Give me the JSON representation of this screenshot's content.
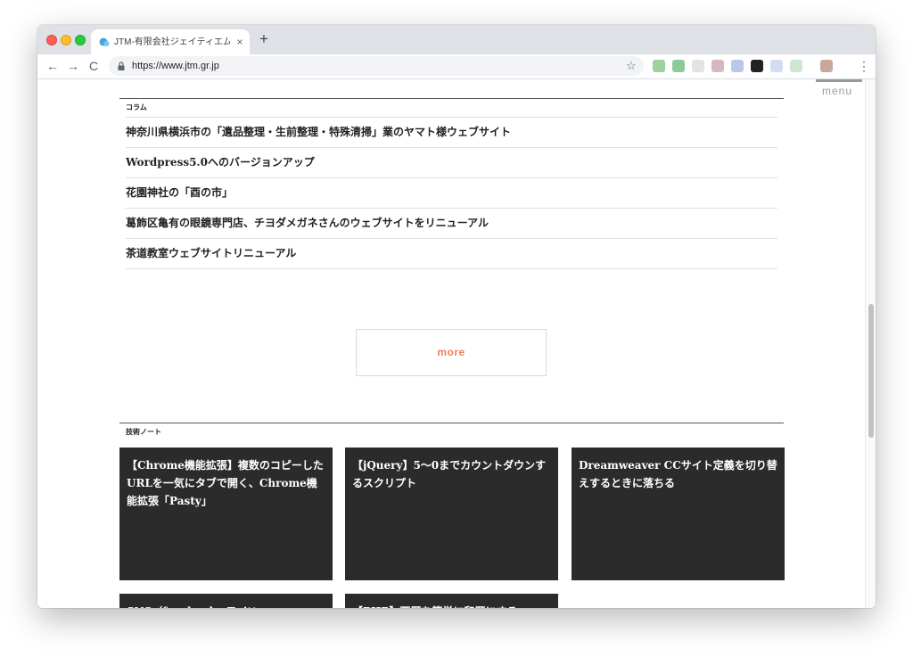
{
  "browser": {
    "tab_title": "JTM-有限会社ジェイティエム [W",
    "tab_close": "×",
    "new_tab": "+",
    "url": "https://www.jtm.gr.jp",
    "back": "←",
    "forward": "→",
    "reload": "C",
    "bookmark_star": "☆",
    "menu_dots": "⋮"
  },
  "site": {
    "menu_label": "menu"
  },
  "column": {
    "heading": "コラム",
    "items": [
      "神奈川県横浜市の「遺品整理・生前整理・特殊清掃」業のヤマト様ウェブサイト",
      "Wordpress5.0へのバージョンアップ",
      "花園神社の「酉の市」",
      "葛飾区亀有の眼鏡専門店、チヨダメガネさんのウェブサイトをリニューアル",
      "茶道教室ウェブサイトリニューアル"
    ],
    "more_label": "more"
  },
  "tech": {
    "heading": "技術ノート",
    "cards": [
      "【Chrome機能拡張】複数のコピーしたURLを一気にタブで開く、Chrome機能拡張「Pasty」",
      "【jQuery】5〜0までカウントダウンするスクリプト",
      "Dreamweaver CCサイト定義を切り替えするときに落ちる",
      "SNS（facebook、Twitter",
      "【PHP】西暦を簡単に和暦にする"
    ]
  },
  "colors": {
    "card_bg": "#2b2b2b",
    "more_text": "#f07e5c",
    "menu_gray": "#9a9a9a"
  }
}
